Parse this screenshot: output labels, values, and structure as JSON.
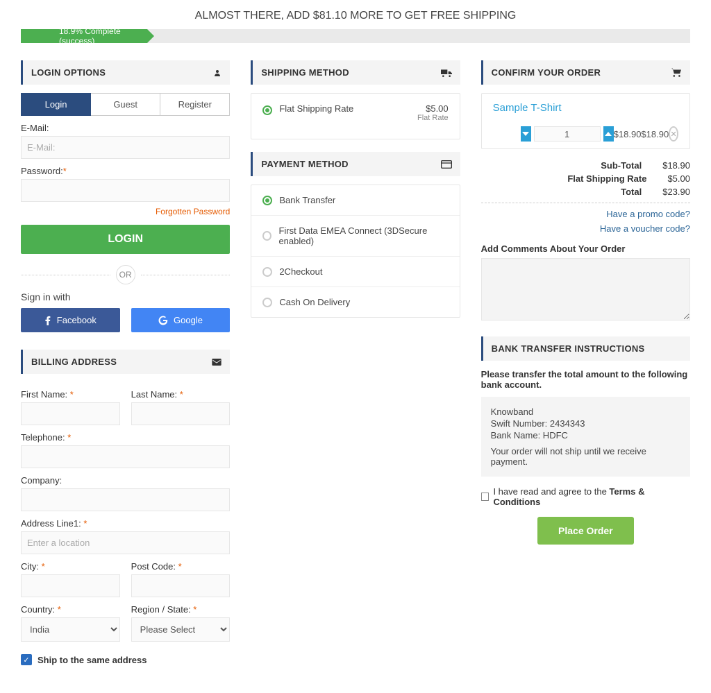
{
  "banner": {
    "text": "ALMOST THERE, ADD $81.10 MORE TO GET FREE SHIPPING"
  },
  "progress": {
    "text": "18.9% Complete (success)",
    "width_pct": 18.9
  },
  "panels": {
    "login": "LOGIN OPTIONS",
    "billing": "BILLING ADDRESS",
    "shipping": "SHIPPING METHOD",
    "payment": "PAYMENT METHOD",
    "confirm": "CONFIRM YOUR ORDER",
    "bank_instr": "BANK TRANSFER INSTRUCTIONS"
  },
  "login_tabs": {
    "login": "Login",
    "guest": "Guest",
    "register": "Register"
  },
  "login_form": {
    "email_label": "E-Mail:",
    "email_placeholder": "E-Mail:",
    "password_label": "Password:",
    "forgot": "Forgotten Password",
    "login_btn": "LOGIN",
    "or": "OR",
    "signin_with": "Sign in with",
    "facebook": "Facebook",
    "google": "Google"
  },
  "billing": {
    "first_name": "First Name:",
    "last_name": "Last Name:",
    "telephone": "Telephone:",
    "company": "Company:",
    "addr1": "Address Line1:",
    "addr1_placeholder": "Enter a location",
    "city": "City:",
    "postcode": "Post Code:",
    "country": "Country:",
    "country_value": "India",
    "region": "Region / State:",
    "region_value": "Please Select",
    "ship_same": "Ship to the same address"
  },
  "shipping": {
    "options": [
      {
        "label": "Flat Shipping Rate",
        "price": "$5.00",
        "sub": "Flat Rate",
        "selected": true
      }
    ]
  },
  "payment": {
    "options": [
      {
        "label": "Bank Transfer",
        "selected": true
      },
      {
        "label": "First Data EMEA Connect (3DSecure enabled)",
        "selected": false
      },
      {
        "label": "2Checkout",
        "selected": false
      },
      {
        "label": "Cash On Delivery",
        "selected": false
      }
    ]
  },
  "order": {
    "item_name": "Sample T-Shirt",
    "qty": "1",
    "unit_price": "$18.90",
    "line_total": "$18.90",
    "totals": [
      {
        "label": "Sub-Total",
        "amount": "$18.90"
      },
      {
        "label": "Flat Shipping Rate",
        "amount": "$5.00"
      },
      {
        "label": "Total",
        "amount": "$23.90"
      }
    ],
    "promo": "Have a promo code?",
    "voucher": "Have a voucher code?",
    "comments_label": "Add Comments About Your Order"
  },
  "bank_instructions": {
    "intro": "Please transfer the total amount to the following bank account.",
    "line1": "Knowband",
    "line2": "Swift Number: 2434343",
    "line3": "Bank Name: HDFC",
    "line4": "Your order will not ship until we receive payment."
  },
  "agree": {
    "prefix": "I have read and agree to the ",
    "tc": "Terms & Conditions"
  },
  "place_order": "Place Order"
}
